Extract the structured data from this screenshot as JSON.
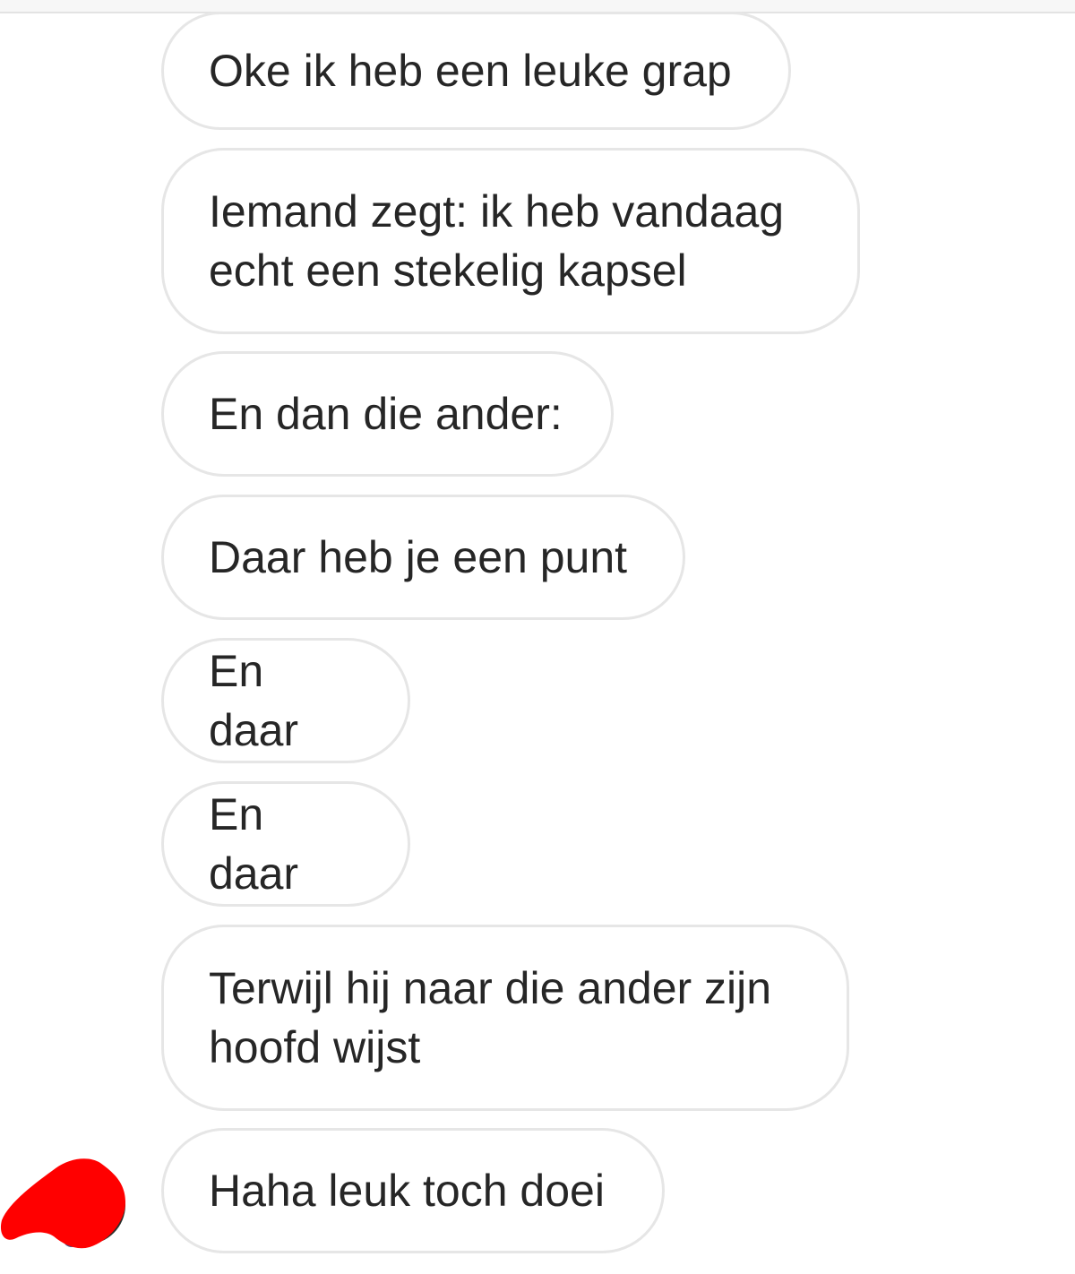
{
  "messages": [
    {
      "text": "Oke ik heb een leuke grap"
    },
    {
      "text": "Iemand zegt: ik heb vandaag\necht een stekelig kapsel"
    },
    {
      "text": "En dan die ander:"
    },
    {
      "text": "Daar heb je een punt"
    },
    {
      "text": "En daar"
    },
    {
      "text": "En daar"
    },
    {
      "text": "Terwijl hij naar die ander zijn\nhoofd wijst"
    },
    {
      "text": "Haha leuk toch doei"
    }
  ],
  "colors": {
    "bubble_border": "#e6e6e6",
    "text": "#262626",
    "redaction": "#ff0000"
  },
  "icons": {
    "avatar": "redacted-avatar-icon"
  }
}
